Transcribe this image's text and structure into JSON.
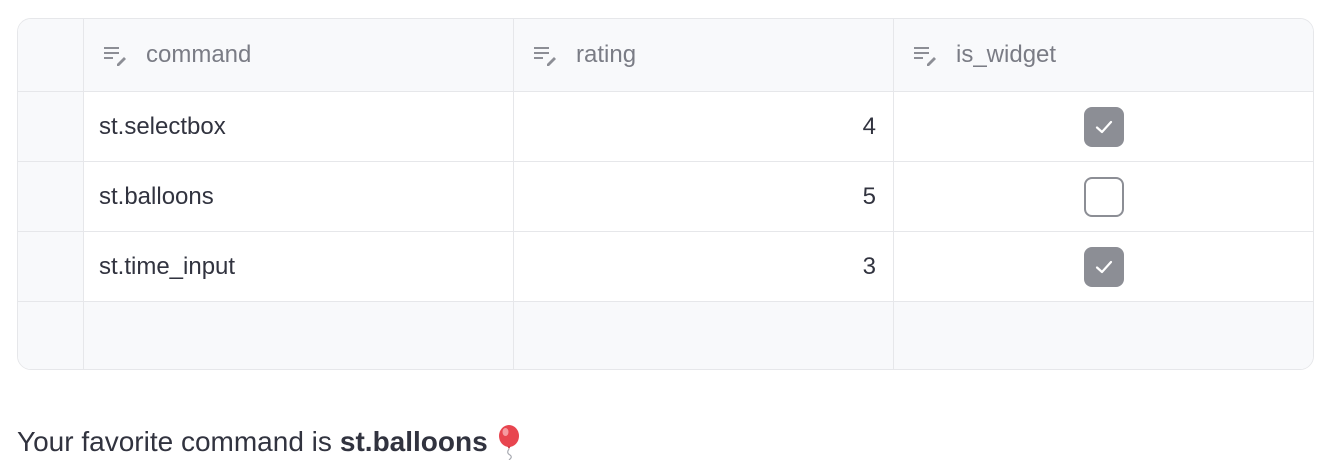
{
  "table": {
    "columns": [
      "command",
      "rating",
      "is_widget"
    ],
    "column_icon": "edit-text-icon",
    "rows": [
      {
        "command": "st.selectbox",
        "rating": "4",
        "is_widget": true
      },
      {
        "command": "st.balloons",
        "rating": "5",
        "is_widget": false
      },
      {
        "command": "st.time_input",
        "rating": "3",
        "is_widget": true
      }
    ]
  },
  "caption": {
    "prefix": "Your favorite command is",
    "value": "st.balloons",
    "icon": "balloon-icon"
  },
  "colors": {
    "border": "#e6e7ea",
    "header_bg": "#f8f9fb",
    "checkbox": "#8c8e95",
    "text": "#31333f",
    "balloon": "#e8454f"
  }
}
